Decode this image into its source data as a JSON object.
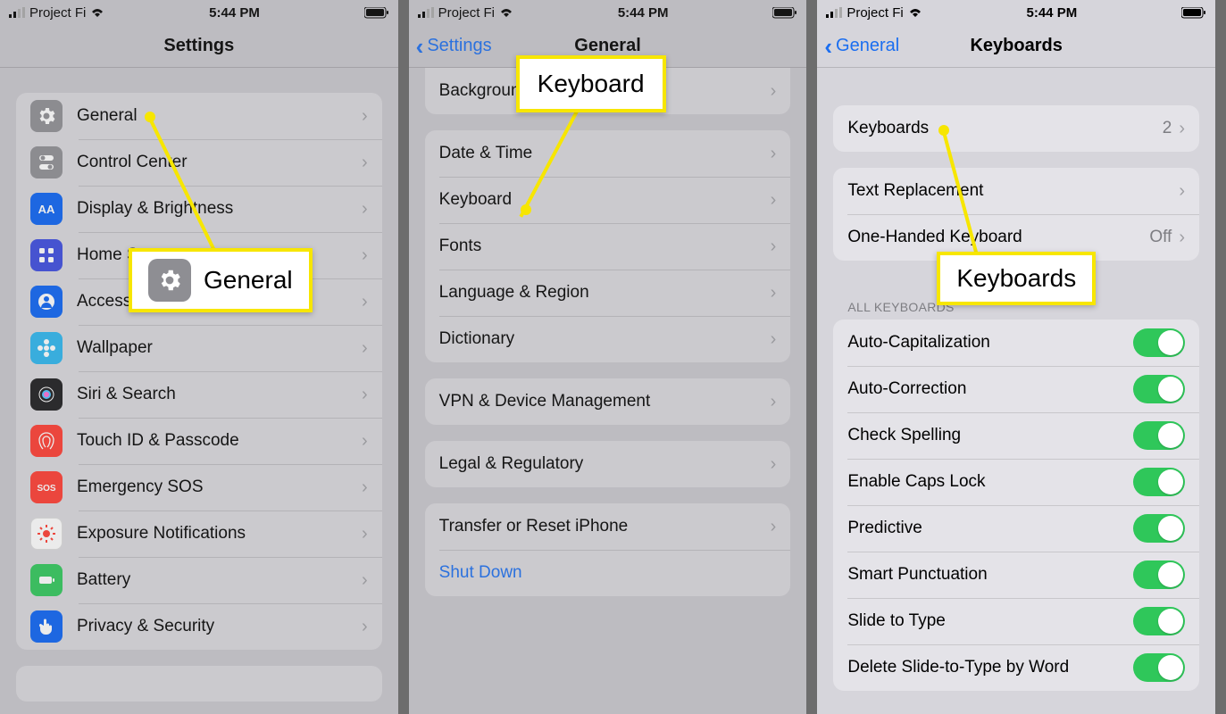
{
  "status": {
    "carrier": "Project Fi",
    "time": "5:44 PM"
  },
  "phone1": {
    "title": "Settings",
    "items": [
      {
        "label": "General",
        "icon": "gear",
        "bg": "#8e8e93"
      },
      {
        "label": "Control Center",
        "icon": "sliders",
        "bg": "#8e8e93"
      },
      {
        "label": "Display & Brightness",
        "icon": "aa",
        "bg": "#0a62f3"
      },
      {
        "label": "Home Screen",
        "icon": "grid",
        "bg": "#3b4bdf"
      },
      {
        "label": "Accessibility",
        "icon": "person",
        "bg": "#0a62f3"
      },
      {
        "label": "Wallpaper",
        "icon": "flower",
        "bg": "#2bb6ef"
      },
      {
        "label": "Siri & Search",
        "icon": "siri",
        "bg": "#1b1b1d"
      },
      {
        "label": "Touch ID & Passcode",
        "icon": "finger",
        "bg": "#ff3b30"
      },
      {
        "label": "Emergency SOS",
        "icon": "sos",
        "bg": "#ff3b30"
      },
      {
        "label": "Exposure Notifications",
        "icon": "exposure",
        "bg": "#fff",
        "fg": "#ff3b30"
      },
      {
        "label": "Battery",
        "icon": "battery",
        "bg": "#2fc75a"
      },
      {
        "label": "Privacy & Security",
        "icon": "hand",
        "bg": "#0a62f3"
      }
    ],
    "callout": {
      "label": "General"
    }
  },
  "phone2": {
    "back": "Settings",
    "title": "General",
    "groups": [
      {
        "rows": [
          {
            "label": "Background App Refresh"
          }
        ],
        "truncated": true
      },
      {
        "rows": [
          {
            "label": "Date & Time"
          },
          {
            "label": "Keyboard"
          },
          {
            "label": "Fonts"
          },
          {
            "label": "Language & Region"
          },
          {
            "label": "Dictionary"
          }
        ]
      },
      {
        "rows": [
          {
            "label": "VPN & Device Management"
          }
        ]
      },
      {
        "rows": [
          {
            "label": "Legal & Regulatory"
          }
        ]
      },
      {
        "rows": [
          {
            "label": "Transfer or Reset iPhone"
          },
          {
            "label": "Shut Down",
            "link": true,
            "nochev": true
          }
        ]
      }
    ],
    "callout": {
      "label": "Keyboard"
    }
  },
  "phone3": {
    "back": "General",
    "title": "Keyboards",
    "g1": [
      {
        "label": "Keyboards",
        "value": "2"
      }
    ],
    "g2": [
      {
        "label": "Text Replacement"
      },
      {
        "label": "One-Handed Keyboard",
        "value": "Off"
      }
    ],
    "section": "ALL KEYBOARDS",
    "g3": [
      {
        "label": "Auto-Capitalization",
        "toggle": true
      },
      {
        "label": "Auto-Correction",
        "toggle": true
      },
      {
        "label": "Check Spelling",
        "toggle": true
      },
      {
        "label": "Enable Caps Lock",
        "toggle": true
      },
      {
        "label": "Predictive",
        "toggle": true
      },
      {
        "label": "Smart Punctuation",
        "toggle": true
      },
      {
        "label": "Slide to Type",
        "toggle": true
      },
      {
        "label": "Delete Slide-to-Type by Word",
        "toggle": true
      }
    ],
    "callout": {
      "label": "Keyboards"
    }
  }
}
